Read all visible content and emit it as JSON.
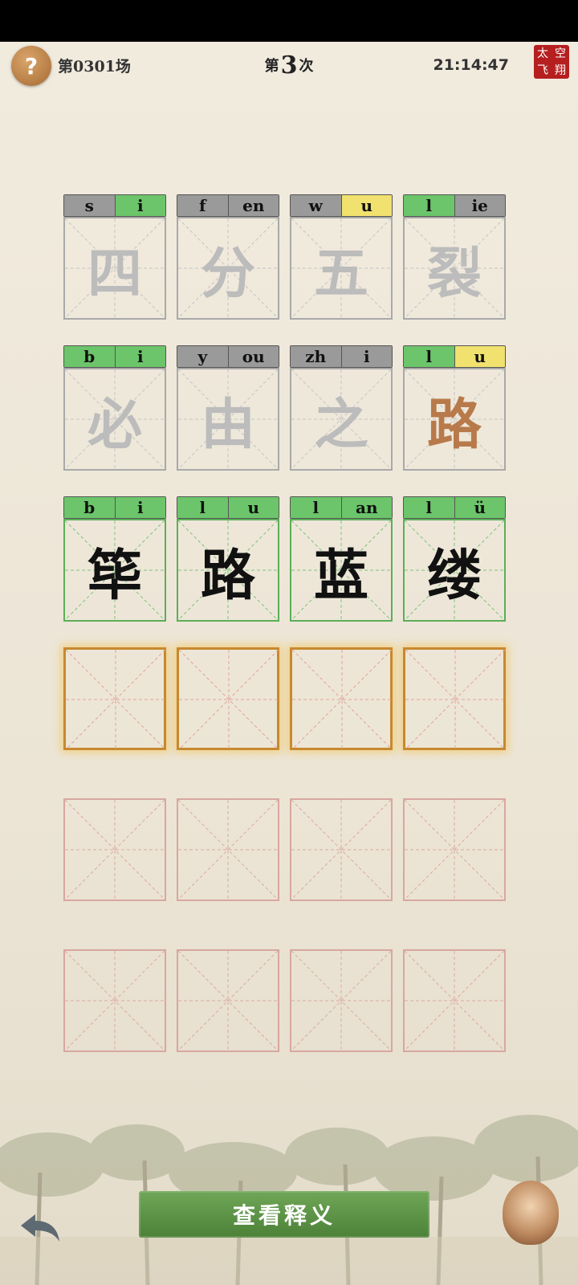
{
  "header": {
    "help_symbol": "?",
    "round_label": "第0301场",
    "attempt_prefix": "第",
    "attempt_number": "3",
    "attempt_suffix": "次",
    "clock": "21:14:47",
    "seal_chars": [
      "太",
      "空",
      "飞",
      "翔"
    ]
  },
  "colors": {
    "gray": "#9a9a9a",
    "green": "#6cc56a",
    "yellow": "#f1e16e",
    "accent": "#c7892f",
    "hint_char": "#b87a4b"
  },
  "rows": [
    {
      "state": "guessed",
      "cells": [
        {
          "char": "四",
          "initial": "s",
          "final": "i",
          "ic": "gray",
          "fc": "green",
          "char_color": "gray"
        },
        {
          "char": "分",
          "initial": "f",
          "final": "en",
          "ic": "gray",
          "fc": "gray",
          "char_color": "gray"
        },
        {
          "char": "五",
          "initial": "w",
          "final": "u",
          "ic": "gray",
          "fc": "yellow",
          "char_color": "gray"
        },
        {
          "char": "裂",
          "initial": "l",
          "final": "ie",
          "ic": "green",
          "fc": "gray",
          "char_color": "gray"
        }
      ]
    },
    {
      "state": "guessed",
      "cells": [
        {
          "char": "必",
          "initial": "b",
          "final": "i",
          "ic": "green",
          "fc": "green",
          "char_color": "gray"
        },
        {
          "char": "由",
          "initial": "y",
          "final": "ou",
          "ic": "gray",
          "fc": "gray",
          "char_color": "gray"
        },
        {
          "char": "之",
          "initial": "zh",
          "final": "i",
          "ic": "gray",
          "fc": "gray",
          "char_color": "gray"
        },
        {
          "char": "路",
          "initial": "l",
          "final": "u",
          "ic": "green",
          "fc": "yellow",
          "char_color": "hint"
        }
      ]
    },
    {
      "state": "answer",
      "cells": [
        {
          "char": "筚",
          "initial": "b",
          "final": "i",
          "ic": "green",
          "fc": "green",
          "char_color": "black"
        },
        {
          "char": "路",
          "initial": "l",
          "final": "u",
          "ic": "green",
          "fc": "green",
          "char_color": "black"
        },
        {
          "char": "蓝",
          "initial": "l",
          "final": "an",
          "ic": "green",
          "fc": "green",
          "char_color": "black"
        },
        {
          "char": "缕",
          "initial": "l",
          "final": "ü",
          "ic": "green",
          "fc": "green",
          "char_color": "black"
        }
      ]
    },
    {
      "state": "active",
      "cells": [
        {},
        {},
        {},
        {}
      ]
    },
    {
      "state": "empty",
      "cells": [
        {},
        {},
        {},
        {}
      ]
    },
    {
      "state": "empty",
      "cells": [
        {},
        {},
        {},
        {}
      ]
    }
  ],
  "footer": {
    "view_meaning_label": "查看释义"
  }
}
